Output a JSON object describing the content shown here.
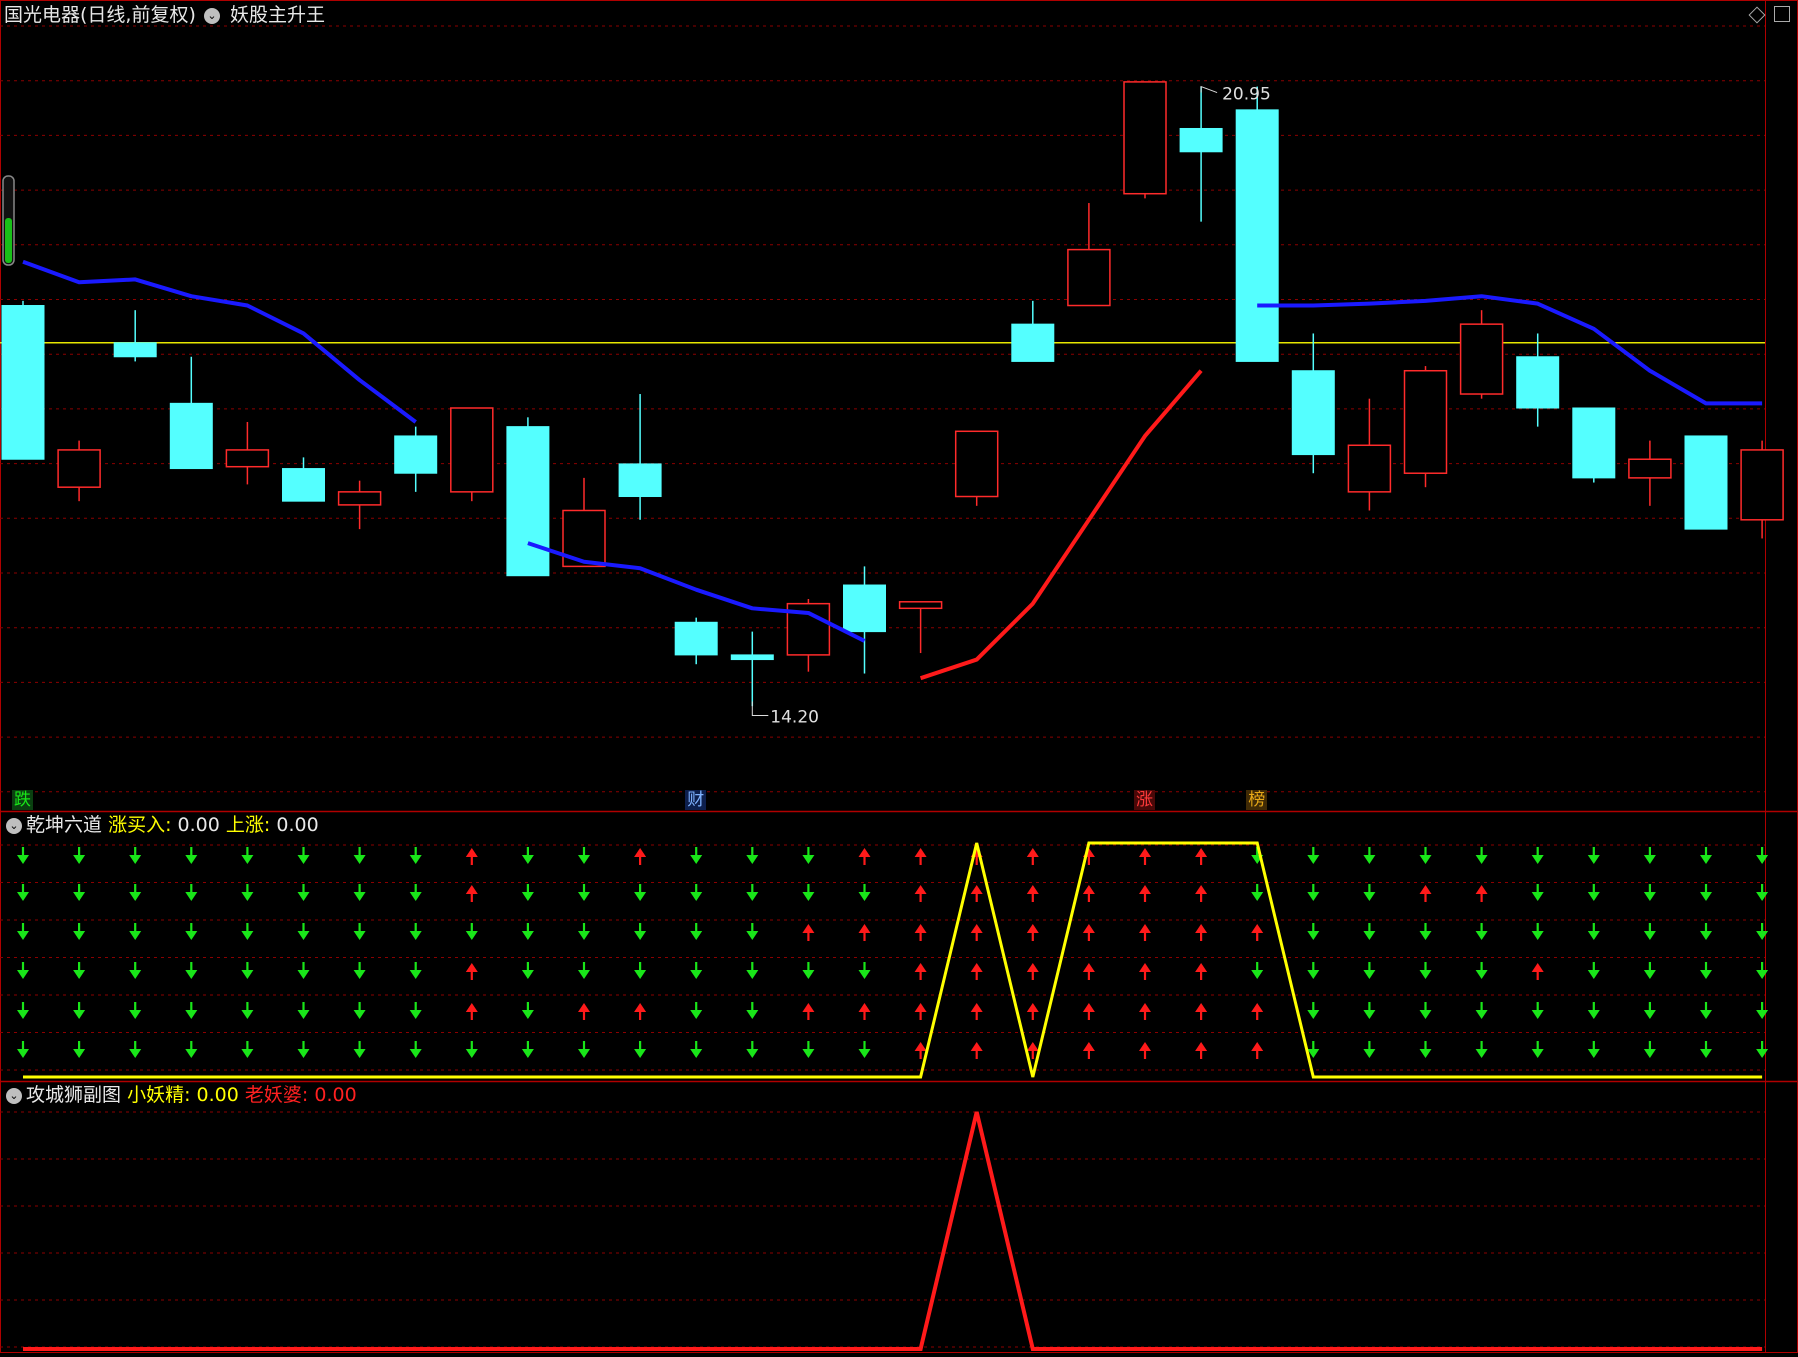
{
  "header": {
    "stock_name": "国光电器(日线,前复权)",
    "indicator_name": "妖股主升王"
  },
  "chart_data": [
    {
      "type": "candlestick",
      "title": "国光电器(日线,前复权)",
      "indicator": "妖股主升王",
      "ylim": [
        13.4,
        21.6
      ],
      "reference_line": 18.2,
      "price_labels": {
        "high": "20.95",
        "low": "14.20"
      },
      "candles": [
        {
          "o": 18.6,
          "h": 18.65,
          "l": 16.95,
          "c": 16.95
        },
        {
          "o": 16.65,
          "h": 17.15,
          "l": 16.5,
          "c": 17.05
        },
        {
          "o": 18.2,
          "h": 18.55,
          "l": 18.0,
          "c": 18.05
        },
        {
          "o": 17.55,
          "h": 18.05,
          "l": 16.85,
          "c": 16.85
        },
        {
          "o": 16.87,
          "h": 17.35,
          "l": 16.68,
          "c": 17.05
        },
        {
          "o": 16.85,
          "h": 16.97,
          "l": 16.5,
          "c": 16.5
        },
        {
          "o": 16.46,
          "h": 16.72,
          "l": 16.2,
          "c": 16.6
        },
        {
          "o": 17.2,
          "h": 17.3,
          "l": 16.6,
          "c": 16.8
        },
        {
          "o": 16.6,
          "h": 17.4,
          "l": 16.5,
          "c": 17.5
        },
        {
          "o": 17.3,
          "h": 17.4,
          "l": 15.7,
          "c": 15.7
        },
        {
          "o": 15.8,
          "h": 16.75,
          "l": 15.8,
          "c": 16.4
        },
        {
          "o": 16.9,
          "h": 17.65,
          "l": 16.3,
          "c": 16.55
        },
        {
          "o": 15.2,
          "h": 15.25,
          "l": 14.75,
          "c": 14.85
        },
        {
          "o": 14.85,
          "h": 15.1,
          "l": 14.3,
          "c": 14.8
        },
        {
          "o": 14.85,
          "h": 15.45,
          "l": 14.67,
          "c": 15.4
        },
        {
          "o": 15.6,
          "h": 15.8,
          "l": 14.65,
          "c": 15.1
        },
        {
          "o": 15.35,
          "h": 15.42,
          "l": 14.87,
          "c": 15.42
        },
        {
          "o": 16.55,
          "h": 17.25,
          "l": 16.45,
          "c": 17.25
        },
        {
          "o": 18.4,
          "h": 18.65,
          "l": 18.0,
          "c": 18.0
        },
        {
          "o": 18.6,
          "h": 19.7,
          "l": 18.6,
          "c": 19.2
        },
        {
          "o": 19.8,
          "h": 20.95,
          "l": 19.75,
          "c": 21.0
        },
        {
          "o": 20.5,
          "h": 20.95,
          "l": 19.5,
          "c": 20.25
        },
        {
          "o": 20.7,
          "h": 20.95,
          "l": 18.0,
          "c": 18.0
        },
        {
          "o": 17.9,
          "h": 18.3,
          "l": 16.8,
          "c": 17.0
        },
        {
          "o": 16.6,
          "h": 17.6,
          "l": 16.4,
          "c": 17.1
        },
        {
          "o": 16.8,
          "h": 17.95,
          "l": 16.65,
          "c": 17.9
        },
        {
          "o": 17.65,
          "h": 18.55,
          "l": 17.6,
          "c": 18.4
        },
        {
          "o": 18.05,
          "h": 18.3,
          "l": 17.3,
          "c": 17.5
        },
        {
          "o": 17.5,
          "h": 17.5,
          "l": 16.7,
          "c": 16.75
        },
        {
          "o": 16.75,
          "h": 17.15,
          "l": 16.45,
          "c": 16.95
        },
        {
          "o": 17.2,
          "h": 17.2,
          "l": 16.2,
          "c": 16.2
        },
        {
          "o": 16.3,
          "h": 17.15,
          "l": 16.1,
          "c": 17.05
        }
      ],
      "blue_line": [
        [
          0,
          19.07
        ],
        [
          1,
          18.85
        ],
        [
          2,
          18.88
        ],
        [
          3,
          18.7
        ],
        [
          4,
          18.6
        ],
        [
          5,
          18.3
        ],
        [
          6,
          17.8
        ],
        [
          7,
          17.35
        ],
        null,
        [
          9,
          16.05
        ],
        [
          10,
          15.85
        ],
        [
          11,
          15.78
        ],
        [
          12,
          15.55
        ],
        [
          13,
          15.35
        ],
        [
          14,
          15.3
        ],
        [
          15,
          15.0
        ],
        null,
        [
          22,
          18.6
        ],
        [
          23,
          18.6
        ],
        [
          24,
          18.62
        ],
        [
          25,
          18.65
        ],
        [
          26,
          18.7
        ],
        [
          27,
          18.62
        ],
        [
          28,
          18.35
        ],
        [
          29,
          17.9
        ],
        [
          30,
          17.55
        ],
        [
          31,
          17.55
        ]
      ],
      "red_line": [
        [
          16,
          14.6
        ],
        [
          17,
          14.8
        ],
        [
          18,
          15.4
        ],
        [
          19,
          16.3
        ],
        [
          20,
          17.2
        ],
        [
          21,
          17.9
        ]
      ],
      "event_tags": [
        {
          "index": 0,
          "text": "跌",
          "color": "#19e619",
          "bg": "#0a4010"
        },
        {
          "index": 12,
          "text": "财",
          "color": "#7fb2ff",
          "bg": "#0d1f4d"
        },
        {
          "index": 20,
          "text": "涨",
          "color": "#ff3a3a",
          "bg": "#4a0808"
        },
        {
          "index": 22,
          "text": "榜",
          "color": "#e6a817",
          "bg": "#402a05"
        }
      ]
    },
    {
      "type": "arrow-grid",
      "title": "乾坤六道",
      "legend": [
        {
          "label": "涨买入",
          "value": "0.00",
          "color": "#ffff00"
        },
        {
          "label": "上涨",
          "value": "0.00",
          "color": "#ffff00"
        }
      ],
      "rows": [
        "DDDDDDDDUDDUDDDUUUUUUUDDDDDDDDDD",
        "DDDDDDDDUDDDDDDDUUUUUUDDDUUDDDDD",
        "DDDDDDDDDDDDDDUUUUUUUUUDDDDDDDDD",
        "DDDDDDDDUDDDDDDDUUUUUUDDDDDUDDDD",
        "DDDDDDDDUDUUDDUUUUUUUUUDDDDDDDDD",
        "DDDDDDDDDDDDDDDDUUUUUUUDDDDDDDDD"
      ],
      "yellow_line": [
        0,
        0,
        0,
        0,
        0,
        0,
        0,
        0,
        0,
        0,
        0,
        0,
        0,
        0,
        0,
        0,
        0,
        1,
        0,
        1,
        1,
        1,
        1,
        0,
        0,
        0,
        0,
        0,
        0,
        0,
        0,
        0
      ]
    },
    {
      "type": "line",
      "title": "攻城狮副图",
      "legend": [
        {
          "label": "小妖精",
          "value": "0.00",
          "color": "#ffff00"
        },
        {
          "label": "老妖婆",
          "value": "0.00",
          "color": "#ff2020"
        }
      ],
      "values": [
        0,
        0,
        0,
        0,
        0,
        0,
        0,
        0,
        0,
        0,
        0,
        0,
        0,
        0,
        0,
        0,
        0,
        1,
        0,
        0,
        0,
        0,
        0,
        0,
        0,
        0,
        0,
        0,
        0,
        0,
        0,
        0
      ]
    }
  ],
  "colors": {
    "up": "#ff2b2b",
    "down": "#54ffff",
    "grid": "#8b0000",
    "border": "#b00000",
    "ma_blue": "#1a1aff",
    "ma_red": "#ff1a1a",
    "reference": "#e6e600",
    "arrow_up": "#ff1a1a",
    "arrow_down": "#19e619",
    "yellow": "#ffff00"
  }
}
